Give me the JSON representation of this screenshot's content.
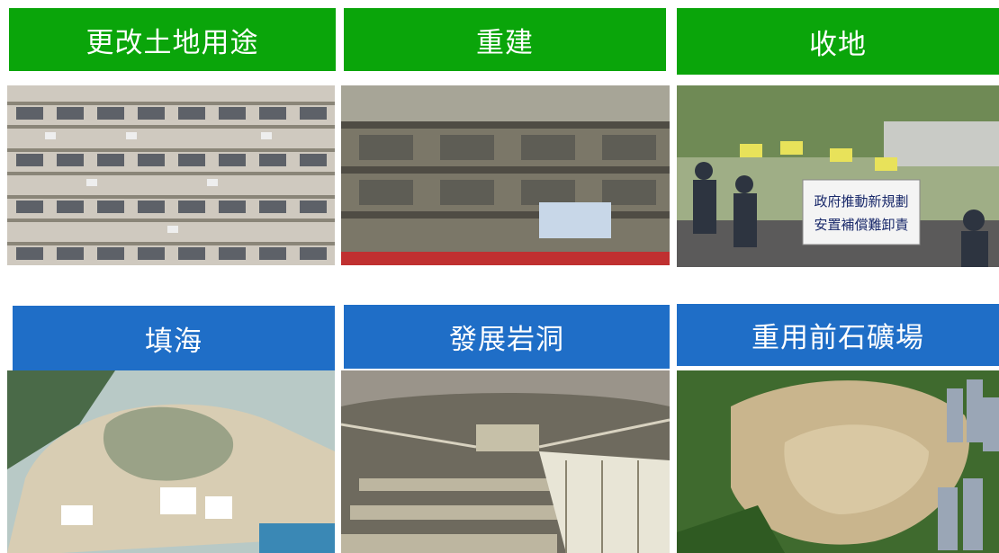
{
  "tiles": [
    {
      "title": "更改土地用途",
      "color": "#0aa50a"
    },
    {
      "title": "重建",
      "color": "#0aa50a"
    },
    {
      "title": "收地",
      "color": "#0aa50a"
    },
    {
      "title": "填海",
      "color": "#1f6ec7"
    },
    {
      "title": "發展岩洞",
      "color": "#1f6ec7"
    },
    {
      "title": "重用前石礦場",
      "color": "#1f6ec7"
    }
  ],
  "protest_banner": {
    "line1": "政府推動新規劃",
    "line2": "安置補償難卸責"
  }
}
